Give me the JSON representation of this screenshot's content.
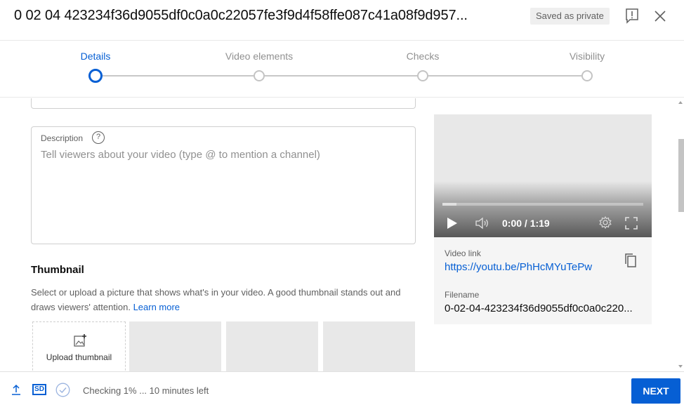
{
  "header": {
    "title": "0 02 04 423234f36d9055df0c0a0c22057fe3f9d4f58ffe087c41a08f9d957...",
    "saved_badge": "Saved as private",
    "feedback_icon": "feedback-icon",
    "close_icon": "close-icon"
  },
  "stepper": {
    "steps": [
      {
        "label": "Details",
        "state": "active"
      },
      {
        "label": "Video elements",
        "state": "pending"
      },
      {
        "label": "Checks",
        "state": "pending"
      },
      {
        "label": "Visibility",
        "state": "pending"
      }
    ]
  },
  "details": {
    "description": {
      "label": "Description",
      "help_glyph": "?",
      "placeholder": "Tell viewers about your video (type @ to mention a channel)",
      "value": ""
    },
    "thumbnail": {
      "heading": "Thumbnail",
      "description": "Select or upload a picture that shows what's in your video. A good thumbnail stands out and draws viewers' attention.",
      "learn_more": "Learn more",
      "upload_label": "Upload thumbnail",
      "slots": 3
    }
  },
  "video_panel": {
    "time_display": "0:00 / 1:19",
    "progress_buffered_fraction": 0.07,
    "video_link_label": "Video link",
    "video_link": "https://youtu.be/PhHcMYuTePw",
    "filename_label": "Filename",
    "filename": "0-02-04-423234f36d9055df0c0a0c220..."
  },
  "footer": {
    "status_text": "Checking 1% ... 10 minutes left",
    "quality_badge": "SD",
    "next_label": "NEXT"
  },
  "colors": {
    "accent": "#065fd4",
    "muted_text": "#606060",
    "placeholder": "#909090"
  }
}
